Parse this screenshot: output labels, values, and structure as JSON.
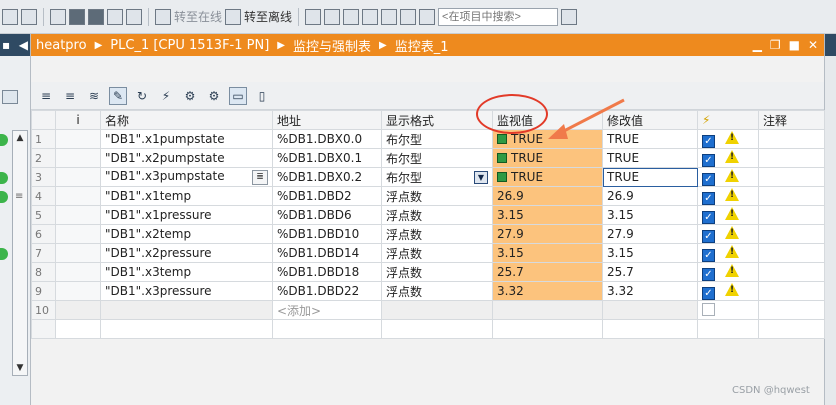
{
  "toolbar": {
    "go_online": "转至在线",
    "go_offline": "转至离线",
    "search_placeholder": "<在项目中搜索>"
  },
  "left_panel": {
    "header_label": "▪"
  },
  "title_bar": {
    "breadcrumbs": [
      "heatpro",
      "PLC_1 [CPU 1513F-1 PN]",
      "监控与强制表",
      "监控表_1"
    ]
  },
  "table": {
    "columns": [
      "i",
      "名称",
      "地址",
      "显示格式",
      "监视值",
      "修改值",
      "⚡",
      "注释"
    ],
    "rows": [
      {
        "num": "1",
        "name": "\"DB1\".x1pumpstate",
        "address": "%DB1.DBX0.0",
        "format": "布尔型",
        "monitor": "TRUE",
        "modify": "TRUE",
        "checked": true
      },
      {
        "num": "2",
        "name": "\"DB1\".x2pumpstate",
        "address": "%DB1.DBX0.1",
        "format": "布尔型",
        "monitor": "TRUE",
        "modify": "TRUE",
        "checked": true
      },
      {
        "num": "3",
        "name": "\"DB1\".x3pumpstate",
        "address": "%DB1.DBX0.2",
        "format": "布尔型",
        "monitor": "TRUE",
        "modify": "TRUE",
        "checked": true
      },
      {
        "num": "4",
        "name": "\"DB1\".x1temp",
        "address": "%DB1.DBD2",
        "format": "浮点数",
        "monitor": "26.9",
        "modify": "26.9",
        "checked": true
      },
      {
        "num": "5",
        "name": "\"DB1\".x1pressure",
        "address": "%DB1.DBD6",
        "format": "浮点数",
        "monitor": "3.15",
        "modify": "3.15",
        "checked": true
      },
      {
        "num": "6",
        "name": "\"DB1\".x2temp",
        "address": "%DB1.DBD10",
        "format": "浮点数",
        "monitor": "27.9",
        "modify": "27.9",
        "checked": true
      },
      {
        "num": "7",
        "name": "\"DB1\".x2pressure",
        "address": "%DB1.DBD14",
        "format": "浮点数",
        "monitor": "3.15",
        "modify": "3.15",
        "checked": true
      },
      {
        "num": "8",
        "name": "\"DB1\".x3temp",
        "address": "%DB1.DBD18",
        "format": "浮点数",
        "monitor": "25.7",
        "modify": "25.7",
        "checked": true
      },
      {
        "num": "9",
        "name": "\"DB1\".x3pressure",
        "address": "%DB1.DBD22",
        "format": "浮点数",
        "monitor": "3.32",
        "modify": "3.32",
        "checked": true
      }
    ],
    "add_row": {
      "num": "10",
      "placeholder": "<添加>"
    }
  },
  "colors": {
    "title_bar": "#ee8a1e",
    "monitor_cell": "#fcc37d",
    "annotation": "#e23a28"
  },
  "watermark": "CSDN @hqwest"
}
